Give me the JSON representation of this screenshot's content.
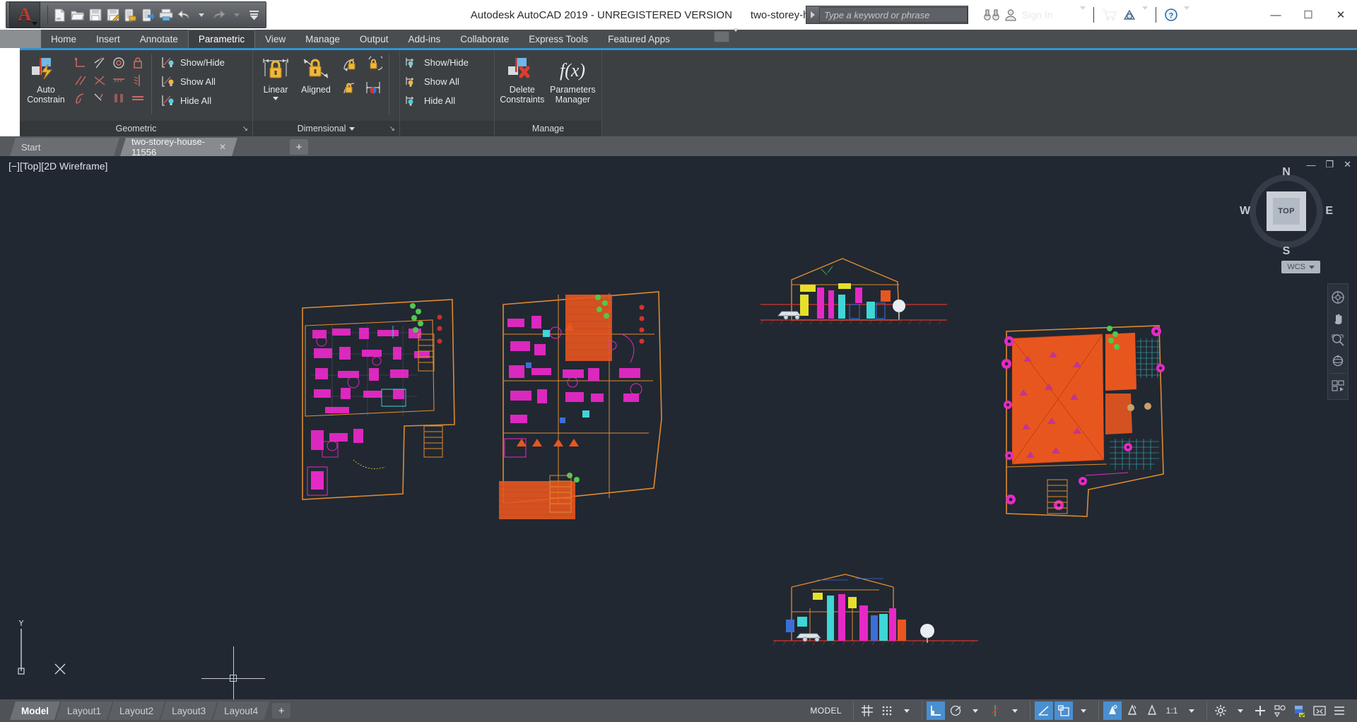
{
  "window": {
    "title": "Autodesk AutoCAD 2019 - UNREGISTERED VERSION",
    "document": "two-storey-house-11556.dwg",
    "minimize": "—",
    "maximize": "☐",
    "close": "✕"
  },
  "search": {
    "placeholder": "Type a keyword or phrase",
    "value": ""
  },
  "account": {
    "sign_in": "Sign In"
  },
  "quick_access": {
    "items": [
      {
        "name": "new-file-icon",
        "tip": "New"
      },
      {
        "name": "open-file-icon",
        "tip": "Open"
      },
      {
        "name": "save-icon",
        "tip": "Save"
      },
      {
        "name": "save-as-icon",
        "tip": "Save As"
      },
      {
        "name": "save-to-web-icon",
        "tip": "Save to Web & Mobile"
      },
      {
        "name": "open-from-web-icon",
        "tip": "Open from Web & Mobile"
      },
      {
        "name": "plot-icon",
        "tip": "Plot"
      },
      {
        "name": "undo-icon",
        "tip": "Undo"
      },
      {
        "name": "redo-icon",
        "tip": "Redo"
      },
      {
        "name": "customize-qat-icon",
        "tip": "Customize"
      }
    ]
  },
  "ribbon": {
    "tabs": [
      {
        "label": "Home",
        "active": false
      },
      {
        "label": "Insert",
        "active": false
      },
      {
        "label": "Annotate",
        "active": false
      },
      {
        "label": "Parametric",
        "active": true
      },
      {
        "label": "View",
        "active": false
      },
      {
        "label": "Manage",
        "active": false
      },
      {
        "label": "Output",
        "active": false
      },
      {
        "label": "Add-ins",
        "active": false
      },
      {
        "label": "Collaborate",
        "active": false
      },
      {
        "label": "Express Tools",
        "active": false
      },
      {
        "label": "Featured Apps",
        "active": false
      }
    ],
    "panels": [
      {
        "title": "Geometric",
        "big_button": {
          "label_line1": "Auto",
          "label_line2": "Constrain",
          "icon": "auto-constrain-icon"
        },
        "constraint_icons": [
          "perpendicular-constraint-icon",
          "tangent-constraint-icon",
          "concentric-constraint-icon",
          "fix-constraint-icon",
          "parallel-constraint-icon",
          "collinear-constraint-icon",
          "horizontal-constraint-icon",
          "vertical-constraint-icon",
          "smooth-constraint-icon",
          "symmetric-constraint-icon",
          "equal-constraint-icon",
          "coincident-constraint-icon"
        ],
        "list": [
          {
            "label": "Show/Hide",
            "icon": "geometric-show-hide-icon"
          },
          {
            "label": "Show All",
            "icon": "geometric-show-all-icon"
          },
          {
            "label": "Hide All",
            "icon": "geometric-hide-all-icon"
          }
        ]
      },
      {
        "title": "Dimensional",
        "has_dropdown": true,
        "big_buttons": [
          {
            "label": "Linear",
            "icon": "linear-dimension-icon",
            "has_dropdown": true
          },
          {
            "label": "Aligned",
            "icon": "aligned-dimension-icon",
            "has_dropdown": false
          }
        ],
        "small_icons": [
          "angular-dimension-icon",
          "radial-dimension-icon",
          "diameter-dimension-icon",
          "convert-dimension-icon"
        ],
        "list": [
          {
            "label": "Show/Hide",
            "icon": "dimensional-show-hide-icon"
          },
          {
            "label": "Show All",
            "icon": "dimensional-show-all-icon"
          },
          {
            "label": "Hide All",
            "icon": "dimensional-hide-all-icon"
          }
        ]
      },
      {
        "title": "Manage",
        "big_buttons": [
          {
            "label_line1": "Delete",
            "label_line2": "Constraints",
            "icon": "delete-constraints-icon"
          },
          {
            "label_line1": "Parameters",
            "label_line2": "Manager",
            "icon": "parameters-manager-icon"
          }
        ]
      }
    ]
  },
  "file_tabs": [
    {
      "label": "Start",
      "active": false,
      "closable": false
    },
    {
      "label": "two-storey-house-11556",
      "active": true,
      "closable": true
    }
  ],
  "file_tab_add": "+",
  "viewport": {
    "label": "[−][Top][2D Wireframe]",
    "controls": {
      "minimize": "—",
      "restore": "❐",
      "close": "✕"
    },
    "viewcube": {
      "face": "TOP",
      "north": "N",
      "south": "S",
      "east": "E",
      "west": "W",
      "wcs": "WCS"
    },
    "nav_icons": [
      "steering-wheel-icon",
      "pan-icon",
      "zoom-extents-icon",
      "orbit-icon",
      "showmotion-icon"
    ],
    "ucs": {
      "y_label": "Y",
      "x_label": "X"
    }
  },
  "drawing": {
    "blocks": [
      {
        "name": "ground-floor-plan"
      },
      {
        "name": "first-floor-plan"
      },
      {
        "name": "front-elevation"
      },
      {
        "name": "rear-elevation"
      },
      {
        "name": "roof-plan"
      }
    ],
    "colors": {
      "outline": "#e08a2e",
      "magenta": "#e629c6",
      "red": "#d6342c",
      "cyan": "#3fd6d6",
      "yellow": "#e6e02a",
      "green": "#4fc94f",
      "orange_fill": "#e8561f",
      "blue": "#3a6fd8"
    }
  },
  "status_bar": {
    "layout_tabs": [
      {
        "label": "Model",
        "active": true
      },
      {
        "label": "Layout1",
        "active": false
      },
      {
        "label": "Layout2",
        "active": false
      },
      {
        "label": "Layout3",
        "active": false
      },
      {
        "label": "Layout4",
        "active": false
      }
    ],
    "layout_add": "+",
    "space_toggle": "MODEL",
    "scale": "1:1",
    "tools": [
      {
        "name": "grid-display-toggle",
        "on": false
      },
      {
        "name": "snap-mode-toggle",
        "on": false
      },
      {
        "name": "snap-dropdown",
        "on": false
      },
      {
        "name": "ortho-mode-toggle",
        "on": true
      },
      {
        "name": "polar-tracking-toggle",
        "on": false
      },
      {
        "name": "polar-dropdown",
        "on": false
      },
      {
        "name": "object-snap-tracking-toggle",
        "on": false
      },
      {
        "name": "osnap-dropdown",
        "on": false
      },
      {
        "name": "dynamic-ucs-toggle",
        "on": true
      },
      {
        "name": "object-snap-toggle",
        "on": true
      },
      {
        "name": "osnap-settings-dropdown",
        "on": false
      },
      {
        "name": "lineweight-toggle",
        "on": true
      },
      {
        "name": "transparency-toggle",
        "on": false
      },
      {
        "name": "selection-cycling-toggle",
        "on": false
      },
      {
        "name": "annotation-scale",
        "on": false
      },
      {
        "name": "workspace-switching",
        "on": false
      },
      {
        "name": "workspace-dropdown",
        "on": false
      },
      {
        "name": "add-tools-button",
        "on": false
      },
      {
        "name": "isolate-objects-icon",
        "on": false
      },
      {
        "name": "hardware-acceleration-icon",
        "on": false
      },
      {
        "name": "clean-screen-icon",
        "on": false
      },
      {
        "name": "customization-menu-icon",
        "on": false
      }
    ]
  }
}
